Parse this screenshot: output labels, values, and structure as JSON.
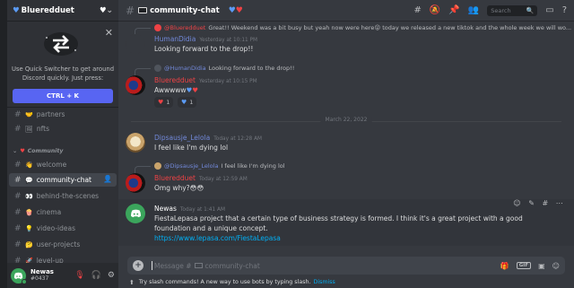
{
  "server": {
    "name": "Blueredduet"
  },
  "quick_switcher": {
    "text": "Use Quick Switcher to get around Discord quickly. Just press:",
    "shortcut": "CTRL + K"
  },
  "channels": {
    "partners": "partners",
    "nfts": "nfts",
    "category": "Community",
    "welcome": "welcome",
    "community_chat": "community-chat",
    "behind_the_scenes": "behind-the-scenes",
    "cinema": "cinema",
    "video_ideas": "video-ideas",
    "user_projects": "user-projects",
    "level_up": "level-up"
  },
  "user": {
    "name": "Newas",
    "tag": "#0437"
  },
  "header": {
    "channel": "community-chat",
    "search_placeholder": "Search"
  },
  "messages": {
    "m1_reply_text": "Great!! Weekend was a bit busy but yeah now were here😜 today we released a new tiktok and the whole week we will wo...",
    "m1_author": "HumanDidia",
    "m1_time": "Yesterday at 10:11 PM",
    "m1_text": "Looking forward to the drop!!",
    "m2_reply_name": "@HumanDidia",
    "m2_reply_text": "Looking forward to the drop!!",
    "m2_author": "Blueredduet",
    "m2_time": "Yesterday at 10:15 PM",
    "m2_text": "Awwwww",
    "reaction1_count": "1",
    "reaction2_count": "1",
    "date_divider": "March 22, 2022",
    "m3_author": "Dipsausje_Lelola",
    "m3_time": "Today at 12:28 AM",
    "m3_text": "I feel like I'm dying lol",
    "m4_reply_name": "@Dipsausje_Lelola",
    "m4_reply_text": "I feel like I'm dying lol",
    "m4_author": "Blueredduet",
    "m4_time": "Today at 12:59 AM",
    "m4_text": "Omg why?",
    "m5_author": "Newas",
    "m5_time": "Today at 1:41 AM",
    "m5_text": "FiestaLepasa project that a certain type of business strategy is formed. I think it's a great project with a good foundation and a unique concept.",
    "m5_link": "https://www.lepasa.com/FiestaLepasa"
  },
  "composer": {
    "placeholder_prefix": "Message #",
    "placeholder_channel": "community-chat",
    "gif_label": "GIF"
  },
  "tip": {
    "text": "Try slash commands! A new way to use bots by typing slash.",
    "dismiss": "Dismiss"
  },
  "colors": {
    "accent": "#5865f2",
    "author_red": "#ed4245",
    "author_blue": "#7289da",
    "link": "#00aff4"
  }
}
